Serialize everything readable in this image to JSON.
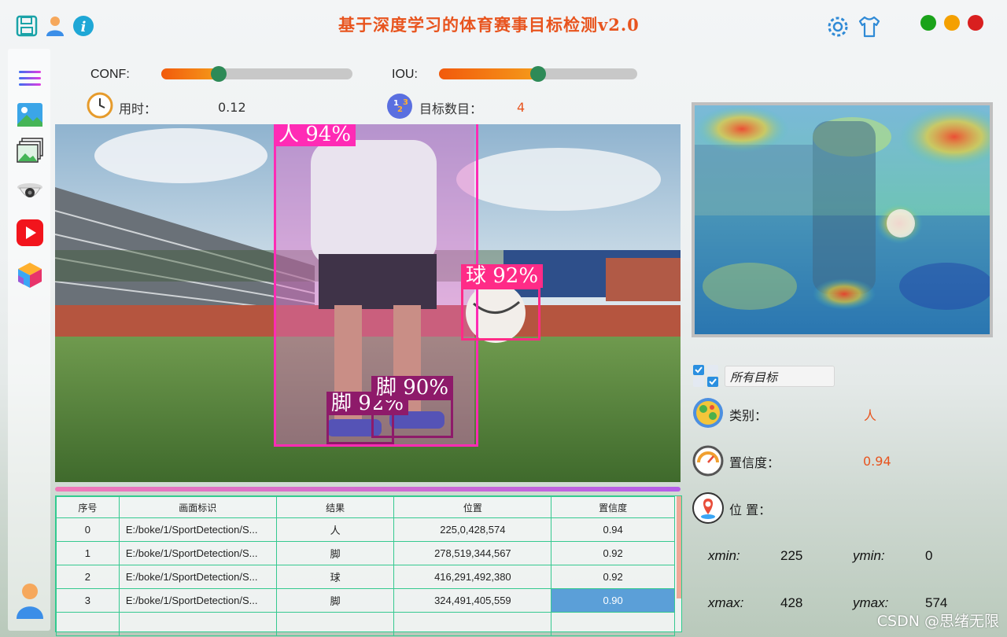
{
  "app": {
    "title": "基于深度学习的体育赛事目标检测v2.0"
  },
  "toolbar": {
    "left_icons": [
      "save-icon",
      "user-icon",
      "info-icon"
    ],
    "right_icons": [
      "settings-icon",
      "tshirt-icon"
    ]
  },
  "window_controls": {
    "colors": [
      "#1aa31a",
      "#f4a000",
      "#d91f1f"
    ]
  },
  "sidebar": {
    "items": [
      "menu-icon",
      "image-icon",
      "folder-images-icon",
      "camera-icon",
      "video-icon",
      "model-icon"
    ],
    "bottom": "user-avatar-icon"
  },
  "controls": {
    "conf_label": "CONF:",
    "conf_value": 0.3,
    "iou_label": "IOU:",
    "iou_value": 0.5,
    "time_label": "用时：",
    "time_value": "0.12",
    "count_label": "目标数目：",
    "count_value": "4"
  },
  "detections": [
    {
      "label": "人 94%",
      "color": "#ff2bb5"
    },
    {
      "label": "球 92%",
      "color": "#ff2b87"
    },
    {
      "label": "脚 92%",
      "color": "#8e1a6a"
    },
    {
      "label": "脚 90%",
      "color": "#8e1a6a"
    }
  ],
  "table": {
    "headers": [
      "序号",
      "画面标识",
      "结果",
      "位置",
      "置信度"
    ],
    "rows": [
      [
        "0",
        "E:/boke/1/SportDetection/S...",
        "人",
        "225,0,428,574",
        "0.94"
      ],
      [
        "1",
        "E:/boke/1/SportDetection/S...",
        "脚",
        "278,519,344,567",
        "0.92"
      ],
      [
        "2",
        "E:/boke/1/SportDetection/S...",
        "球",
        "416,291,492,380",
        "0.92"
      ],
      [
        "3",
        "E:/boke/1/SportDetection/S...",
        "脚",
        "324,491,405,559",
        "0.90"
      ]
    ]
  },
  "right_panel": {
    "target_select": "所有目标",
    "class_label": "类别：",
    "class_value": "人",
    "conf_label": "置信度：",
    "conf_value": "0.94",
    "pos_label": "位 置：",
    "xmin_label": "xmin:",
    "xmin": "225",
    "ymin_label": "ymin:",
    "ymin": "0",
    "xmax_label": "xmax:",
    "xmax": "428",
    "ymax_label": "ymax:",
    "ymax": "574"
  },
  "watermark": "CSDN @思绪无限"
}
